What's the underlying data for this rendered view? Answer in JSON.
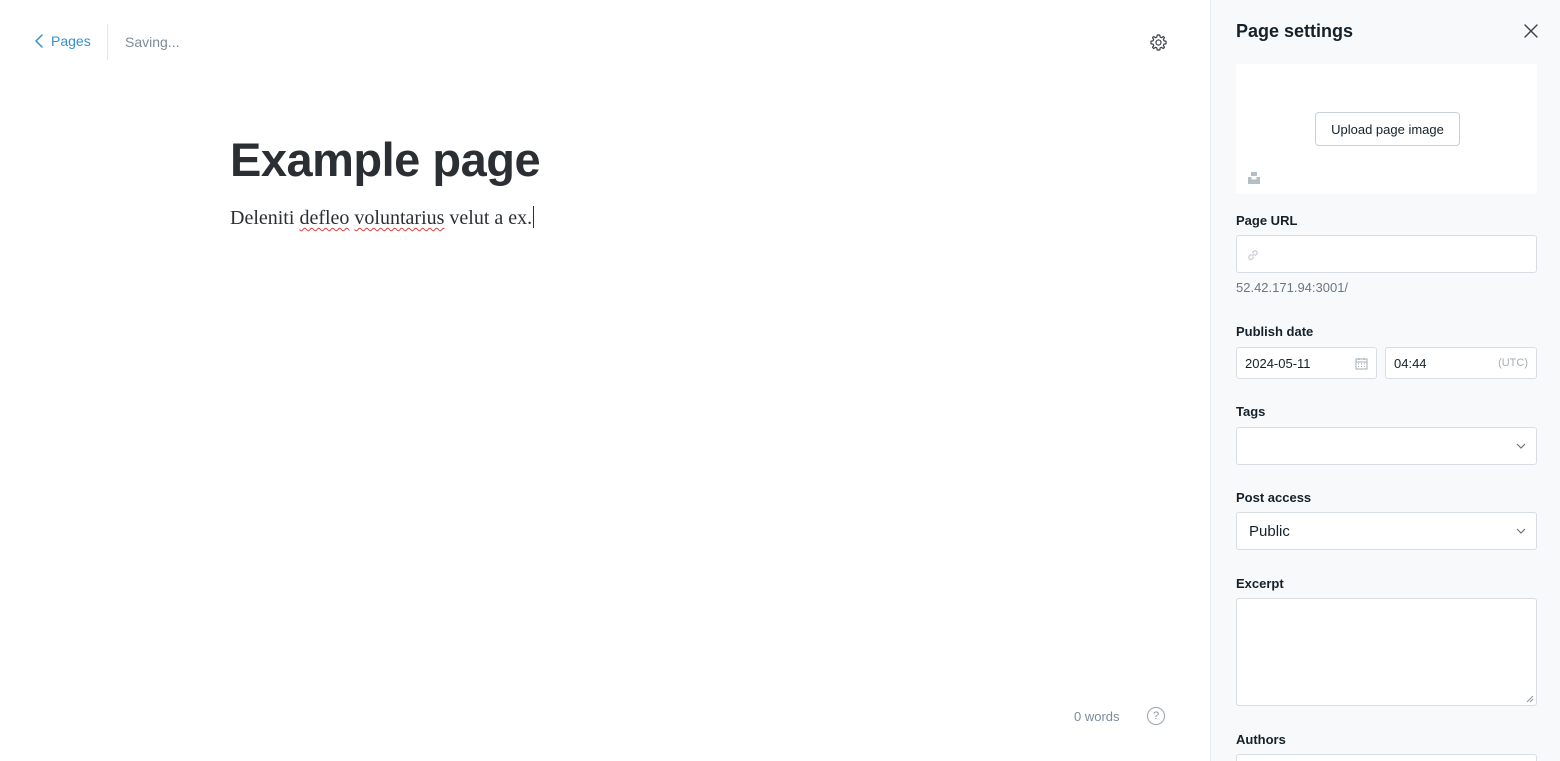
{
  "editor": {
    "back_label": "Pages",
    "status": "Saving...",
    "title": "Example page",
    "body_words": [
      "Deleniti",
      "defleo",
      "voluntarius",
      "velut a ex."
    ],
    "word_count": "0 words",
    "help_label": "?"
  },
  "panel": {
    "title": "Page settings",
    "upload_label": "Upload page image",
    "url_label": "Page URL",
    "url_value": "",
    "url_hint": "52.42.171.94:3001/",
    "publish_label": "Publish date",
    "date_value": "2024-05-11",
    "time_value": "04:44",
    "timezone": "(UTC)",
    "tags_label": "Tags",
    "access_label": "Post access",
    "access_value": "Public",
    "excerpt_label": "Excerpt",
    "excerpt_value": "",
    "authors_label": "Authors"
  },
  "colors": {
    "accent": "#3590d0",
    "text": "#15212a",
    "muted": "#7c8b9a",
    "panel_bg": "#f8f9fa",
    "spellcheck": "#e03b3b"
  },
  "icons": [
    "chevron-left-icon",
    "gear-icon",
    "close-icon",
    "unsplash-icon",
    "link-icon",
    "calendar-icon",
    "chevron-down-icon",
    "help-icon"
  ]
}
